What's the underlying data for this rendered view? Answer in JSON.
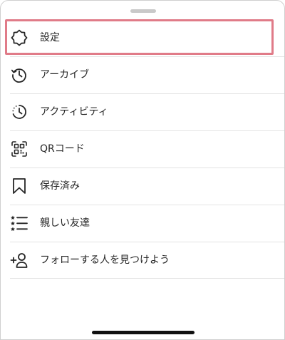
{
  "menu": {
    "items": [
      {
        "label": "設定",
        "icon": "gear-icon"
      },
      {
        "label": "アーカイブ",
        "icon": "archive-history-icon"
      },
      {
        "label": "アクティビティ",
        "icon": "activity-clock-icon"
      },
      {
        "label": "QRコード",
        "icon": "qr-code-icon"
      },
      {
        "label": "保存済み",
        "icon": "bookmark-icon"
      },
      {
        "label": "親しい友達",
        "icon": "close-friends-list-icon"
      },
      {
        "label": "フォローする人を見つけよう",
        "icon": "add-person-icon"
      }
    ]
  },
  "colors": {
    "text": "#262626",
    "highlight": "#e07b88",
    "divider": "#e3e3e3"
  }
}
